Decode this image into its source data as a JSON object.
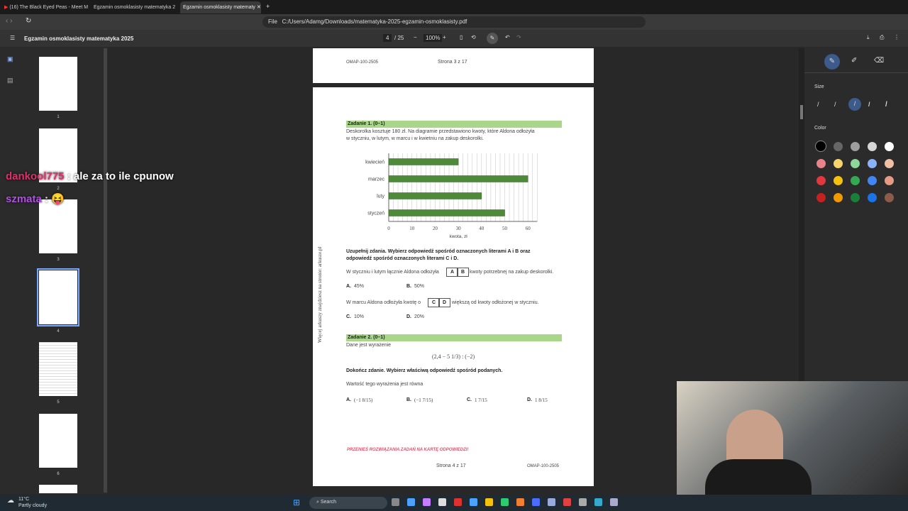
{
  "tabs": [
    {
      "label": "(16) The Black Eyed Peas - Meet M"
    },
    {
      "label": "Egzamin osmoklasisty matematyka 2"
    },
    {
      "label": "Egzamin osmoklasisty matematy"
    }
  ],
  "address": {
    "scheme": "File",
    "url": "C:/Users/Adamg/Downloads/matematyka-2025-egzamin-osmoklasisty.pdf"
  },
  "pdf": {
    "title": "Egzamin osmoklasisty matematyka 2025",
    "page": "4",
    "total": "/ 25",
    "zoom": "100%"
  },
  "thumbnails": [
    "1",
    "2",
    "3",
    "4",
    "5",
    "6"
  ],
  "page3": {
    "code": "OMAP-100-2505",
    "footer": "Strona 3 z 17"
  },
  "side_note": "Więcej arkuszy znajdziesz na stronie: arkusze.pl",
  "task1": {
    "header": "Zadanie 1. (0–1)",
    "intro1": "Deskorolka kosztuje  180 zł. Na diagramie przedstawiono kwoty, które Aldona odłożyła",
    "intro2": "w styczniu, w lutym, w marcu i w kwietniu na zakup deskorolki.",
    "instr1": "Uzupełnij zdania. Wybierz odpowiedź spośród oznaczonych literami A i B oraz",
    "instr2": "odpowiedź spośród oznaczonych literami C i D.",
    "s1a": "W styczniu i lutym łącznie Aldona odłożyła",
    "s1b": "kwoty potrzebnej na zakup deskorolki.",
    "box1": [
      "A",
      "B"
    ],
    "optA": "A.",
    "optAv": "45%",
    "optB": "B.",
    "optBv": "50%",
    "s2a": "W marcu Aldona odłożyła kwotę o",
    "s2b": "większą od kwoty odłożonej w styczniu.",
    "box2": [
      "C",
      "D"
    ],
    "optC": "C.",
    "optCv": "10%",
    "optD": "D.",
    "optDv": "20%"
  },
  "chart_data": {
    "type": "bar",
    "orientation": "horizontal",
    "categories": [
      "kwiecień",
      "marzec",
      "luty",
      "styczeń"
    ],
    "values": [
      30,
      60,
      40,
      50
    ],
    "xlabel": "kwota, zł",
    "xlim": [
      0,
      64
    ],
    "xticks": [
      "0",
      "10",
      "20",
      "30",
      "40",
      "50",
      "60"
    ],
    "grid": true,
    "bar_color": "#4e8a3a"
  },
  "task2": {
    "header": "Zadanie 2. (0–1)",
    "intro": "Dane jest wyrażenie",
    "expr": "(2,4 − 5 1/3) : (−2)",
    "instr": "Dokończ zdanie. Wybierz właściwą odpowiedź spośród podanych.",
    "stem": "Wartość tego wyrażenia jest równa",
    "options": [
      {
        "letter": "A.",
        "value": "(−1 8/15)"
      },
      {
        "letter": "B.",
        "value": "(−1 7/15)"
      },
      {
        "letter": "C.",
        "value": "1 7/15"
      },
      {
        "letter": "D.",
        "value": "1 8/15"
      }
    ]
  },
  "page4": {
    "notice": "PRZENIEŚ ROZWIĄZANIA ZADAŃ NA KARTĘ ODPOWIEDZI!",
    "footer": "Strona 4 z 17",
    "code": "OMAP-100-2505"
  },
  "panel": {
    "size_label": "Size",
    "color_label": "Color",
    "colors": [
      "#000000",
      "#666666",
      "#9e9e9e",
      "#d6d6d6",
      "#ffffff",
      "#e8838a",
      "#f6d36b",
      "#8ed69a",
      "#8ab4f8",
      "#f0c0a6",
      "#e0383e",
      "#f4c20d",
      "#34a853",
      "#4285f4",
      "#e59a86",
      "#c5221f",
      "#f29900",
      "#188038",
      "#1a73e8",
      "#8d5b4c"
    ]
  },
  "chat": [
    {
      "user": "dankool775",
      "msg": ": ale za to ile cpunow"
    },
    {
      "user": "szmata",
      "msg": ": 😝"
    }
  ],
  "taskbar": {
    "temp": "11°C",
    "weather": "Partly cloudy",
    "search": "Search"
  }
}
